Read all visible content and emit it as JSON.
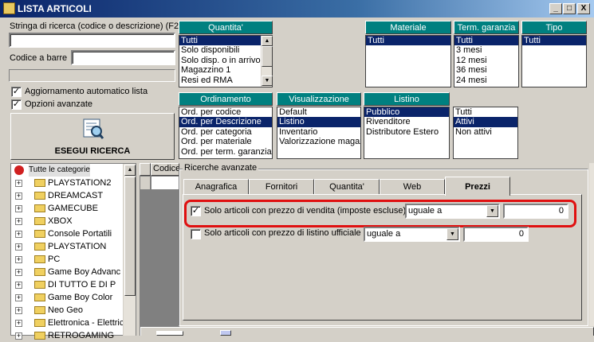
{
  "window": {
    "title": "LISTA ARTICOLI",
    "min": "_",
    "max": "□",
    "close": "X"
  },
  "search": {
    "label": "Stringa di ricerca (codice o descrizione) (F2)",
    "value": "",
    "barcode_label": "Codice a barre",
    "barcode_value": ""
  },
  "options": {
    "auto_update": {
      "label": "Aggiornamento automatico lista",
      "checked": true
    },
    "advanced": {
      "label": "Opzioni avanzate",
      "checked": true
    }
  },
  "search_button": {
    "label": "ESEGUI RICERCA",
    "icon": "search-list-icon"
  },
  "quantita": {
    "header": "Quantita'",
    "items": [
      "Tutti",
      "Solo disponibili",
      "Solo disp. o in arrivo",
      "Magazzino 1",
      "Resi ed RMA"
    ],
    "selected": 0
  },
  "materiale": {
    "header": "Materiale",
    "items": [
      "Tutti"
    ],
    "selected": 0
  },
  "garanzia": {
    "header": "Term. garanzia",
    "items": [
      "Tutti",
      "3 mesi",
      "12 mesi",
      "36 mesi",
      "24 mesi"
    ],
    "selected": 0
  },
  "tipo": {
    "header": "Tipo",
    "items": [
      "Tutti"
    ],
    "selected": 0
  },
  "ordinamento": {
    "header": "Ordinamento",
    "items": [
      "Ord. per codice",
      "Ord. per Descrizione",
      "Ord. per categoria",
      "Ord. per materiale",
      "Ord. per term. garanzia"
    ],
    "selected": 1
  },
  "visualizzazione": {
    "header": "Visualizzazione",
    "items": [
      "Default",
      "Listino",
      "Inventario",
      "Valorizzazione magaz"
    ],
    "selected": 1
  },
  "listino": {
    "header": "Listino",
    "items": [
      "Pubblico",
      "Rivenditore",
      "Distributore Estero"
    ],
    "selected": 0
  },
  "attivi": {
    "items": [
      "Tutti",
      "Attivi",
      "Non attivi"
    ],
    "selected": 1
  },
  "tree": {
    "root": "Tutte le categorie",
    "items": [
      "PLAYSTATION2",
      "DREAMCAST",
      "GAMECUBE",
      "XBOX",
      "Console Portatili",
      "PLAYSTATION",
      "PC",
      "Game Boy Advanc",
      "DI TUTTO E DI P",
      "Game Boy Color",
      "Neo Geo",
      "Elettronica - Elettric",
      "RETROGAMING"
    ]
  },
  "grid": {
    "column": "Codice"
  },
  "advanced": {
    "group_label": "Ricerche avanzate",
    "tabs": [
      "Anagrafica",
      "Fornitori",
      "Quantita'",
      "Web",
      "Prezzi"
    ],
    "active_tab": 4,
    "rows": [
      {
        "label": "Solo articoli con prezzo di vendita (imposte escluse)",
        "checked": true,
        "operator": "uguale a",
        "value": "0"
      },
      {
        "label": "Solo articoli con prezzo di listino ufficiale",
        "checked": false,
        "operator": "uguale a",
        "value": "0"
      }
    ]
  },
  "colors": {
    "header_teal": "#008080",
    "selection": "#0a246a",
    "highlight_red": "#e01010"
  }
}
